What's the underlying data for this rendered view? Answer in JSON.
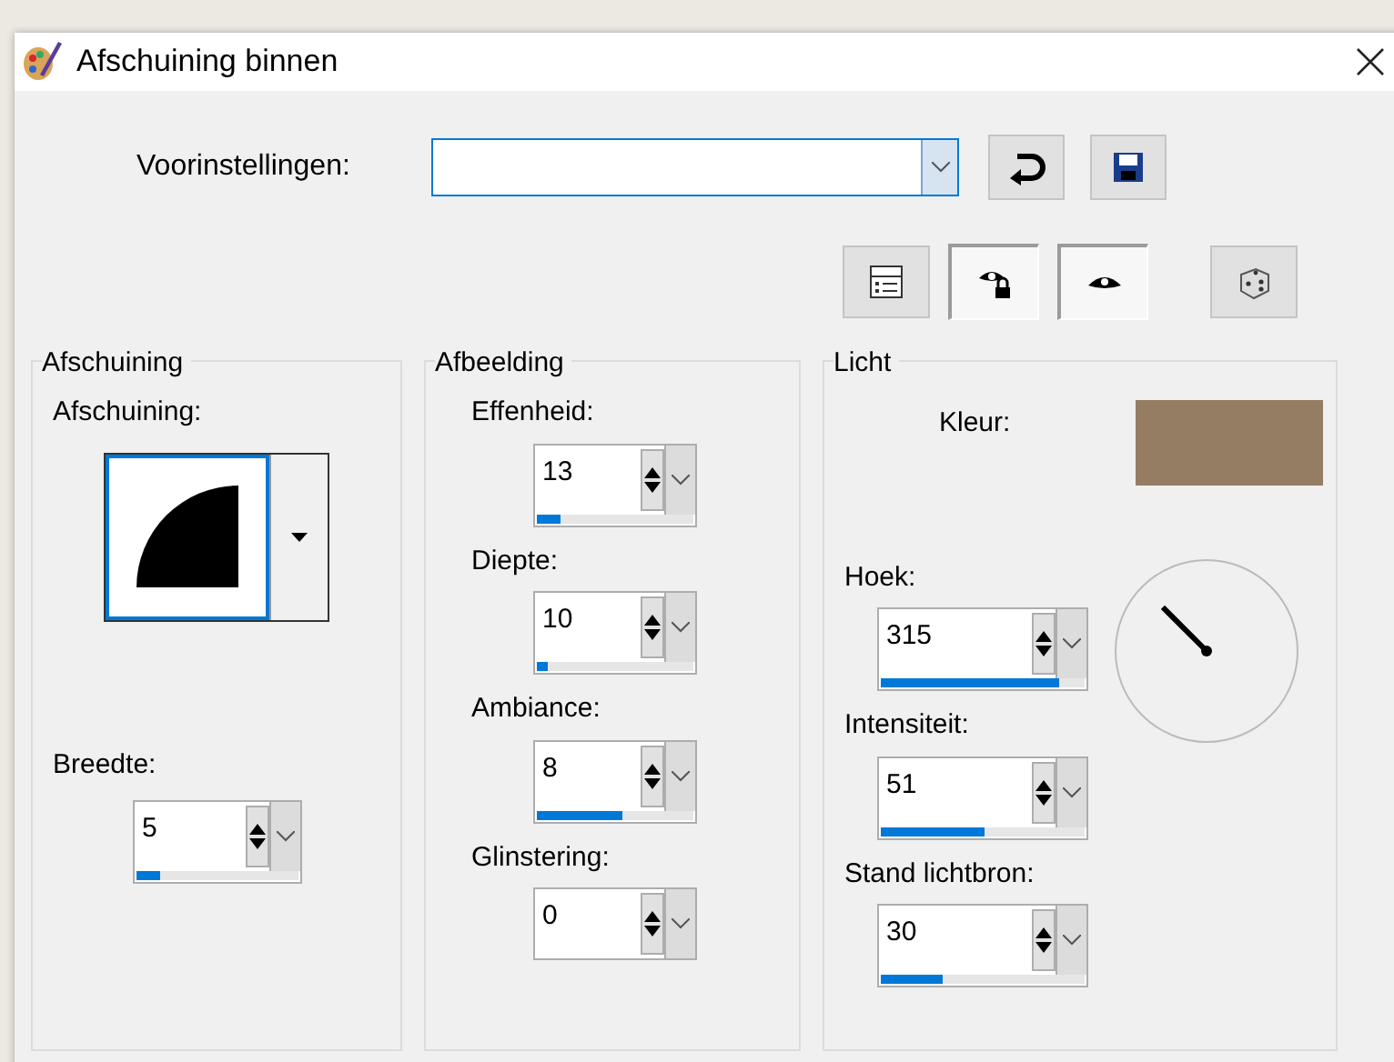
{
  "window": {
    "title": "Afschuining binnen"
  },
  "presets": {
    "label": "Voorinstellingen:",
    "buttons": [
      {
        "kind": "reset"
      },
      {
        "kind": "save"
      }
    ]
  },
  "toolbar": [
    {
      "kind": "proof",
      "pressed": false
    },
    {
      "kind": "lock-eye",
      "pressed": true
    },
    {
      "kind": "eye",
      "pressed": true
    },
    {
      "kind": "dice",
      "pressed": false
    }
  ],
  "bevel_group": {
    "title": "Afschuining",
    "shape_label": "Afschuining:",
    "width_label": "Breedte:",
    "width": {
      "value": "5",
      "level": 0.15
    }
  },
  "image_group": {
    "title": "Afbeelding",
    "fields": [
      {
        "label": "Effenheid:",
        "value": "13",
        "level": 0.15
      },
      {
        "label": "Diepte:",
        "value": "10",
        "level": 0.07
      },
      {
        "label": "Ambiance:",
        "value": "8",
        "level": 0.55
      },
      {
        "label": "Glinstering:",
        "value": "0"
      }
    ]
  },
  "light_group": {
    "title": "Licht",
    "color_label": "Kleur:",
    "color": "#957d63",
    "fields": [
      {
        "label": "Hoek:",
        "value": "315",
        "level": 0.875
      },
      {
        "label": "Intensiteit:",
        "value": "51",
        "level": 0.51
      },
      {
        "label": "Stand lichtbron:",
        "value": "30",
        "level": 0.3
      }
    ]
  }
}
